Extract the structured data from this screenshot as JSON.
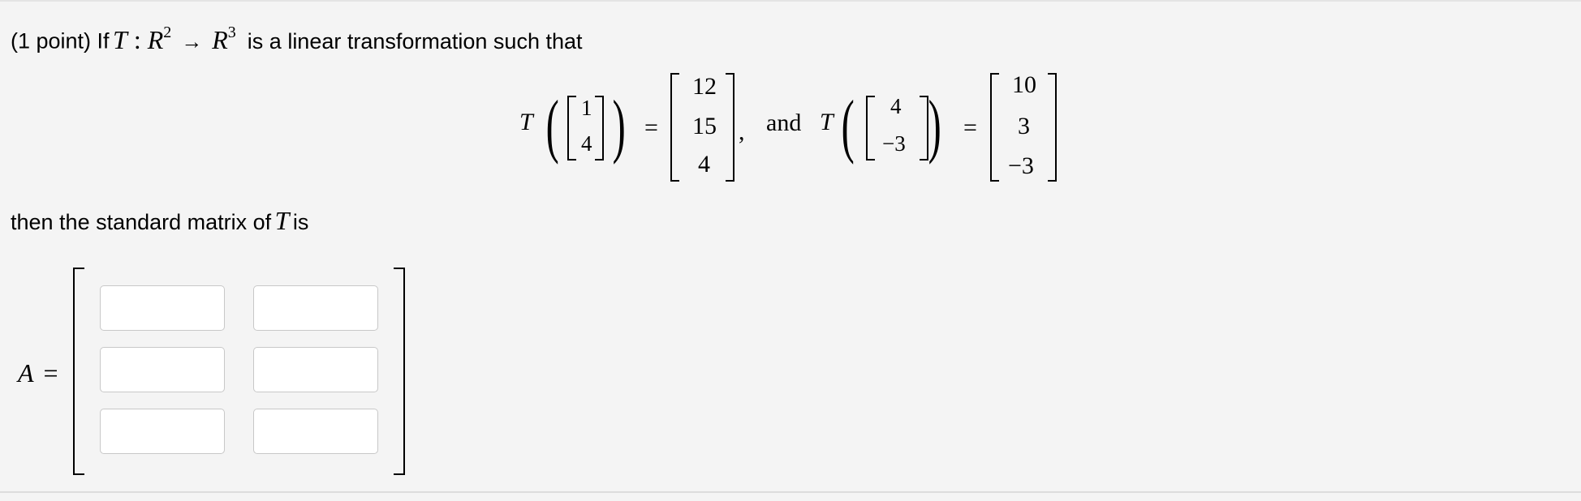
{
  "question": {
    "points_prefix": "(1 point) If",
    "transform_symbol": "T",
    "colon": ":",
    "domain": "R",
    "domain_exp": "2",
    "arrow": "→",
    "codomain": "R",
    "codomain_exp": "3",
    "intro_suffix": "is a linear transformation such that"
  },
  "equation": {
    "T": "T",
    "input1": [
      "1",
      "4"
    ],
    "output1": [
      "12",
      "15",
      "4"
    ],
    "input2": [
      "4",
      "−3"
    ],
    "output2": [
      "10",
      "3",
      "−3"
    ],
    "equals": "=",
    "comma": ",",
    "and": "and"
  },
  "conclusion": {
    "prefix": "then the standard matrix of",
    "symbol": "T",
    "suffix": "is"
  },
  "answer": {
    "label": "A",
    "equals": "=",
    "cells": [
      [
        "",
        ""
      ],
      [
        "",
        ""
      ],
      [
        "",
        ""
      ]
    ]
  }
}
